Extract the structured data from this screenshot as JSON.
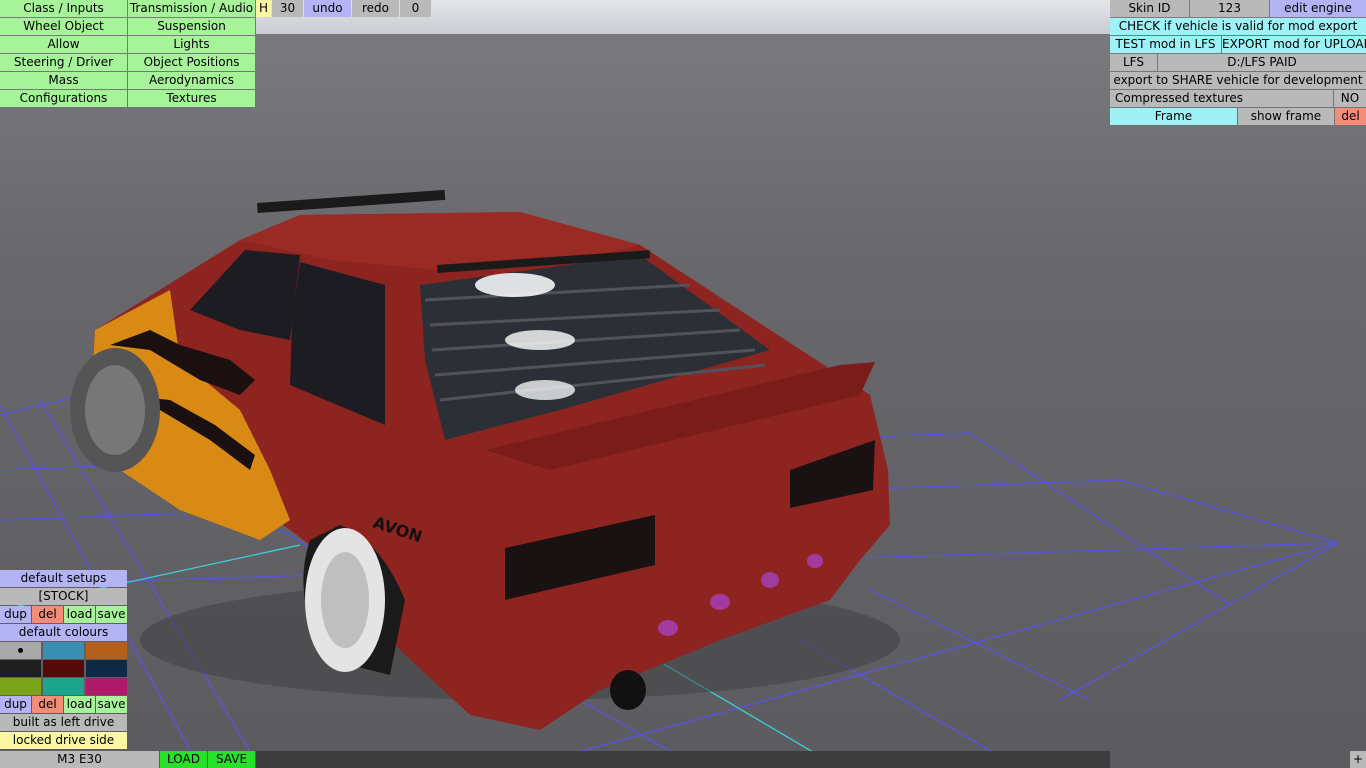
{
  "menu": {
    "left_col": [
      "Class / Inputs",
      "Wheel Object",
      "Allow",
      "Steering / Driver",
      "Mass",
      "Configurations"
    ],
    "right_col": [
      "Transmission / Audio",
      "Suspension",
      "Lights",
      "Object Positions",
      "Aerodynamics",
      "Textures"
    ]
  },
  "toolbar": {
    "h_label": "H",
    "count": "30",
    "undo": "undo",
    "redo": "redo",
    "redo_count": "0"
  },
  "right_panel": {
    "skin_id_label": "Skin ID",
    "skin_id_value": "123",
    "edit_engine": "edit engine",
    "check_valid": "CHECK if vehicle is valid for mod export",
    "test_mod": "TEST mod in LFS",
    "export_upload": "EXPORT mod for UPLOAD",
    "lfs_label": "LFS",
    "lfs_path": "D:/LFS PAID",
    "export_share": "export to SHARE vehicle for development",
    "compressed_label": "Compressed textures",
    "compressed_value": "NO",
    "frame": "Frame",
    "show_frame": "show frame",
    "del": "del"
  },
  "setups": {
    "default_setups": "default setups",
    "stock": "[STOCK]",
    "dup": "dup",
    "del": "del",
    "load": "load",
    "save": "save"
  },
  "colours": {
    "default_colours": "default colours",
    "swatches": [
      "#a9a9a9",
      "#3a8fb0",
      "#b5601a",
      "#1e1e1e",
      "#560a0a",
      "#0f2a45",
      "#7aa21a",
      "#1ca58a",
      "#b01a6a"
    ],
    "dup": "dup",
    "del": "del",
    "load": "load",
    "save": "save",
    "built_as": "built as left drive",
    "locked": "locked drive side"
  },
  "footer": {
    "car_name": "M3 E30",
    "load": "LOAD",
    "save": "SAVE",
    "plus": "+"
  }
}
